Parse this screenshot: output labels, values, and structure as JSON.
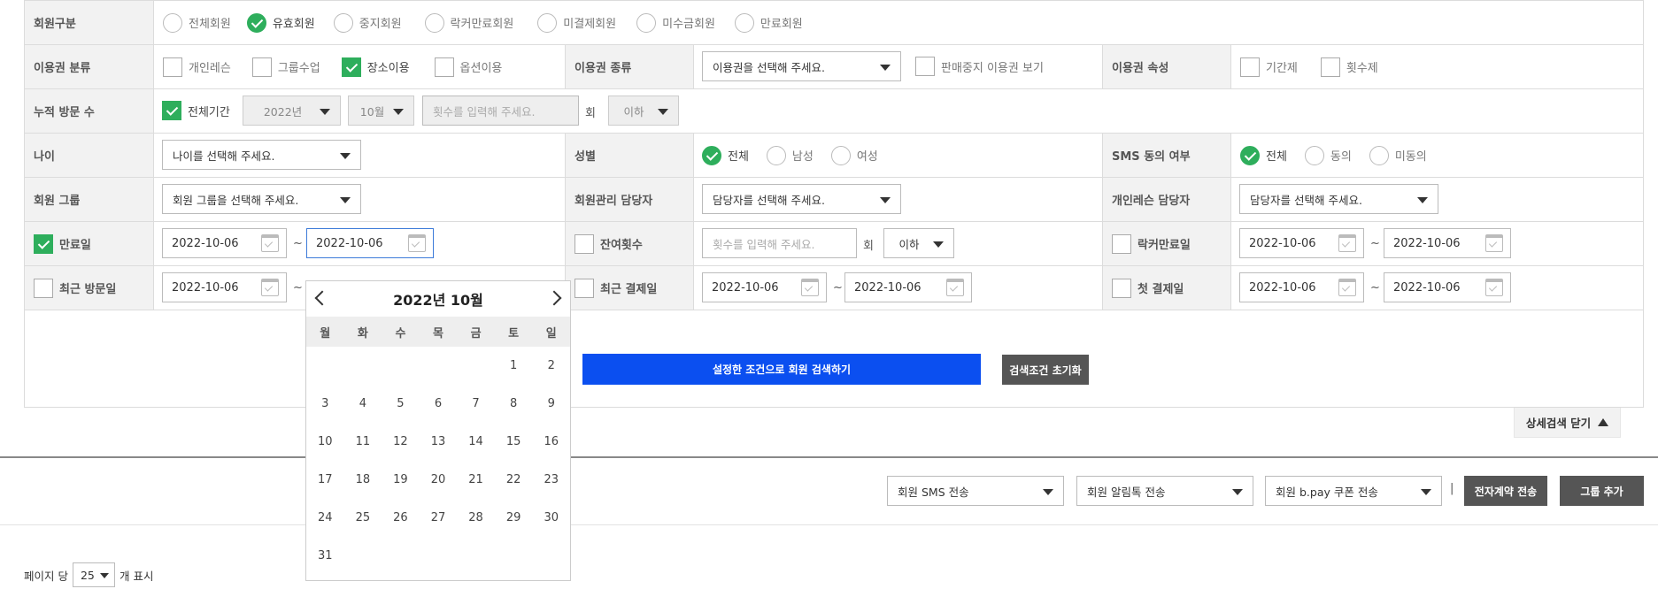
{
  "rows": {
    "member_type": {
      "label": "회원구분",
      "options": [
        {
          "label": "전체회원",
          "selected": false
        },
        {
          "label": "유효회원",
          "selected": true
        },
        {
          "label": "중지회원",
          "selected": false
        },
        {
          "label": "락커만료회원",
          "selected": false
        },
        {
          "label": "미결제회원",
          "selected": false
        },
        {
          "label": "미수금회원",
          "selected": false
        },
        {
          "label": "만료회원",
          "selected": false
        }
      ]
    },
    "pass_category": {
      "label": "이용권 분류",
      "options": [
        {
          "label": "개인레슨",
          "checked": false
        },
        {
          "label": "그룹수업",
          "checked": false
        },
        {
          "label": "장소이용",
          "checked": true
        },
        {
          "label": "옵션이용",
          "checked": false
        }
      ]
    },
    "pass_kind": {
      "label": "이용권 종류",
      "select": "이용권을 선택해 주세요.",
      "suspended_label": "판매중지 이용권 보기",
      "suspended_checked": false
    },
    "pass_attr": {
      "label": "이용권 속성",
      "options": [
        {
          "label": "기간제",
          "checked": false
        },
        {
          "label": "횟수제",
          "checked": false
        }
      ]
    },
    "visits": {
      "label": "누적 방문 수",
      "all_period": "전체기간",
      "all_checked": true,
      "year": "2022년",
      "month": "10월",
      "count_placeholder": "횟수를 입력해 주세요.",
      "unit": "회",
      "cond": "이하"
    },
    "age": {
      "label": "나이",
      "select": "나이를 선택해 주세요."
    },
    "gender": {
      "label": "성별",
      "options": [
        {
          "label": "전체",
          "selected": true
        },
        {
          "label": "남성",
          "selected": false
        },
        {
          "label": "여성",
          "selected": false
        }
      ]
    },
    "sms": {
      "label": "SMS 동의 여부",
      "options": [
        {
          "label": "전체",
          "selected": true
        },
        {
          "label": "동의",
          "selected": false
        },
        {
          "label": "미동의",
          "selected": false
        }
      ]
    },
    "group": {
      "label": "회원 그룹",
      "select": "회원 그룹을 선택해 주세요."
    },
    "manager": {
      "label": "회원관리 담당자",
      "select": "담당자를 선택해 주세요."
    },
    "lesson_manager": {
      "label": "개인레슨 담당자",
      "select": "담당자를 선택해 주세요."
    },
    "expire": {
      "label": "만료일",
      "checked": true,
      "from": "2022-10-06",
      "to": "2022-10-06"
    },
    "remain": {
      "label": "잔여횟수",
      "checked": false,
      "placeholder": "횟수를 입력해 주세요.",
      "unit": "회",
      "cond": "이하"
    },
    "locker_expire": {
      "label": "락커만료일",
      "checked": false,
      "from": "2022-10-06",
      "to": "2022-10-06"
    },
    "recent_visit": {
      "label": "최근 방문일",
      "checked": false,
      "from": "2022-10-06"
    },
    "recent_pay": {
      "label": "최근 결제일",
      "checked": false,
      "from": "2022-10-06",
      "to": "2022-10-06"
    },
    "first_pay": {
      "label": "첫 결제일",
      "checked": false,
      "from": "2022-10-06",
      "to": "2022-10-06"
    }
  },
  "tilde": "~",
  "buttons": {
    "search": "설정한 조건으로 회원 검색하기",
    "reset": "검색조건 초기화",
    "detail_close": "상세검색 닫기",
    "contract": "전자계약 전송",
    "group_add": "그룹 추가"
  },
  "actions": {
    "sms": "회원 SMS 전송",
    "alimtalk": "회원 알림톡 전송",
    "coupon": "회원 b.pay 쿠폰 전송",
    "sep": "|"
  },
  "calendar": {
    "title": "2022년 10월",
    "weekdays": [
      "월",
      "화",
      "수",
      "목",
      "금",
      "토",
      "일"
    ],
    "days": [
      "",
      "",
      "",
      "",
      "",
      "1",
      "2",
      "3",
      "4",
      "5",
      "6",
      "7",
      "8",
      "9",
      "10",
      "11",
      "12",
      "13",
      "14",
      "15",
      "16",
      "17",
      "18",
      "19",
      "20",
      "21",
      "22",
      "23",
      "24",
      "25",
      "26",
      "27",
      "28",
      "29",
      "30",
      "31"
    ]
  },
  "paging": {
    "prefix": "페이지 당",
    "value": "25",
    "suffix": "개 표시"
  }
}
